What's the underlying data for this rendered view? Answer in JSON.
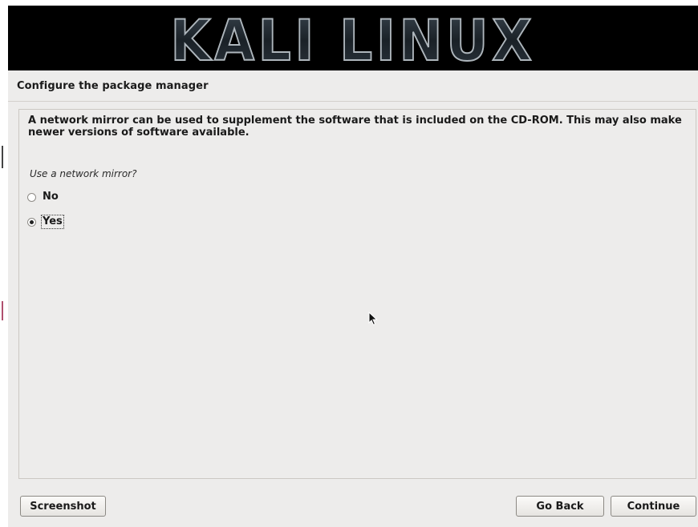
{
  "banner": {
    "logo_text": "KALI LINUX"
  },
  "page": {
    "title": "Configure the package manager",
    "description": "A network mirror can be used to supplement the software that is included on the CD-ROM. This may also make newer versions of software available.",
    "question": "Use a network mirror?"
  },
  "options": [
    {
      "label": "No",
      "selected": false
    },
    {
      "label": "Yes",
      "selected": true
    }
  ],
  "buttons": {
    "screenshot": "Screenshot",
    "go_back": "Go Back",
    "continue": "Continue"
  },
  "colors": {
    "banner_bg": "#000000",
    "window_bg": "#edeceb",
    "logo_fill": "#1e252b",
    "logo_stroke": "#aeb6bc"
  },
  "icons": {
    "cursor": "mouse-pointer-icon"
  }
}
